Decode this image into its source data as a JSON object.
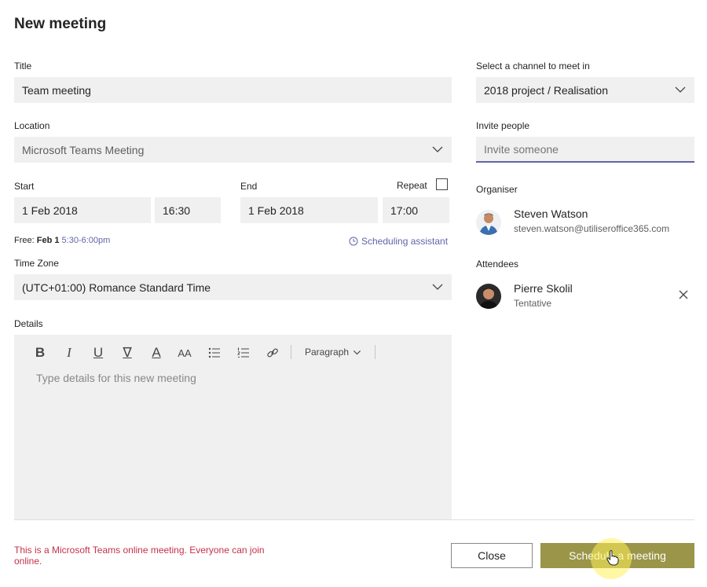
{
  "dialog": {
    "title": "New meeting"
  },
  "form": {
    "title_label": "Title",
    "title_value": "Team meeting",
    "location_label": "Location",
    "location_value": "Microsoft Teams Meeting",
    "start_label": "Start",
    "start_date": "1 Feb 2018",
    "start_time": "16:30",
    "end_label": "End",
    "end_date": "1 Feb 2018",
    "end_time": "17:00",
    "repeat_label": "Repeat",
    "free_prefix": "Free:",
    "free_date": "Feb 1",
    "free_time": "5:30-6:00pm",
    "scheduling_assistant": "Scheduling assistant",
    "timezone_label": "Time Zone",
    "timezone_value": "(UTC+01:00) Romance Standard Time",
    "details_label": "Details",
    "details_placeholder": "Type details for this new meeting",
    "paragraph_label": "Paragraph"
  },
  "toolbar": {
    "bold": "B",
    "italic": "I",
    "underline": "U",
    "highlight": "∇",
    "font_color": "A",
    "font_size": "AA"
  },
  "side": {
    "channel_label": "Select a channel to meet in",
    "channel_value": "2018 project / Realisation",
    "invite_label": "Invite people",
    "invite_placeholder": "Invite someone",
    "organiser_label": "Organiser",
    "organiser_name": "Steven Watson",
    "organiser_email": "steven.watson@utiliseroffice365.com",
    "attendees_label": "Attendees",
    "attendee_name": "Pierre Skolil",
    "attendee_status": "Tentative"
  },
  "footer": {
    "notice": "This is a Microsoft Teams online meeting. Everyone can join online.",
    "close": "Close",
    "schedule": "Schedule a meeting"
  },
  "colors": {
    "accent": "#6264a7",
    "notice": "#c4314b",
    "schedule_bg": "#9a9548",
    "field_bg": "#f0f0f1"
  }
}
